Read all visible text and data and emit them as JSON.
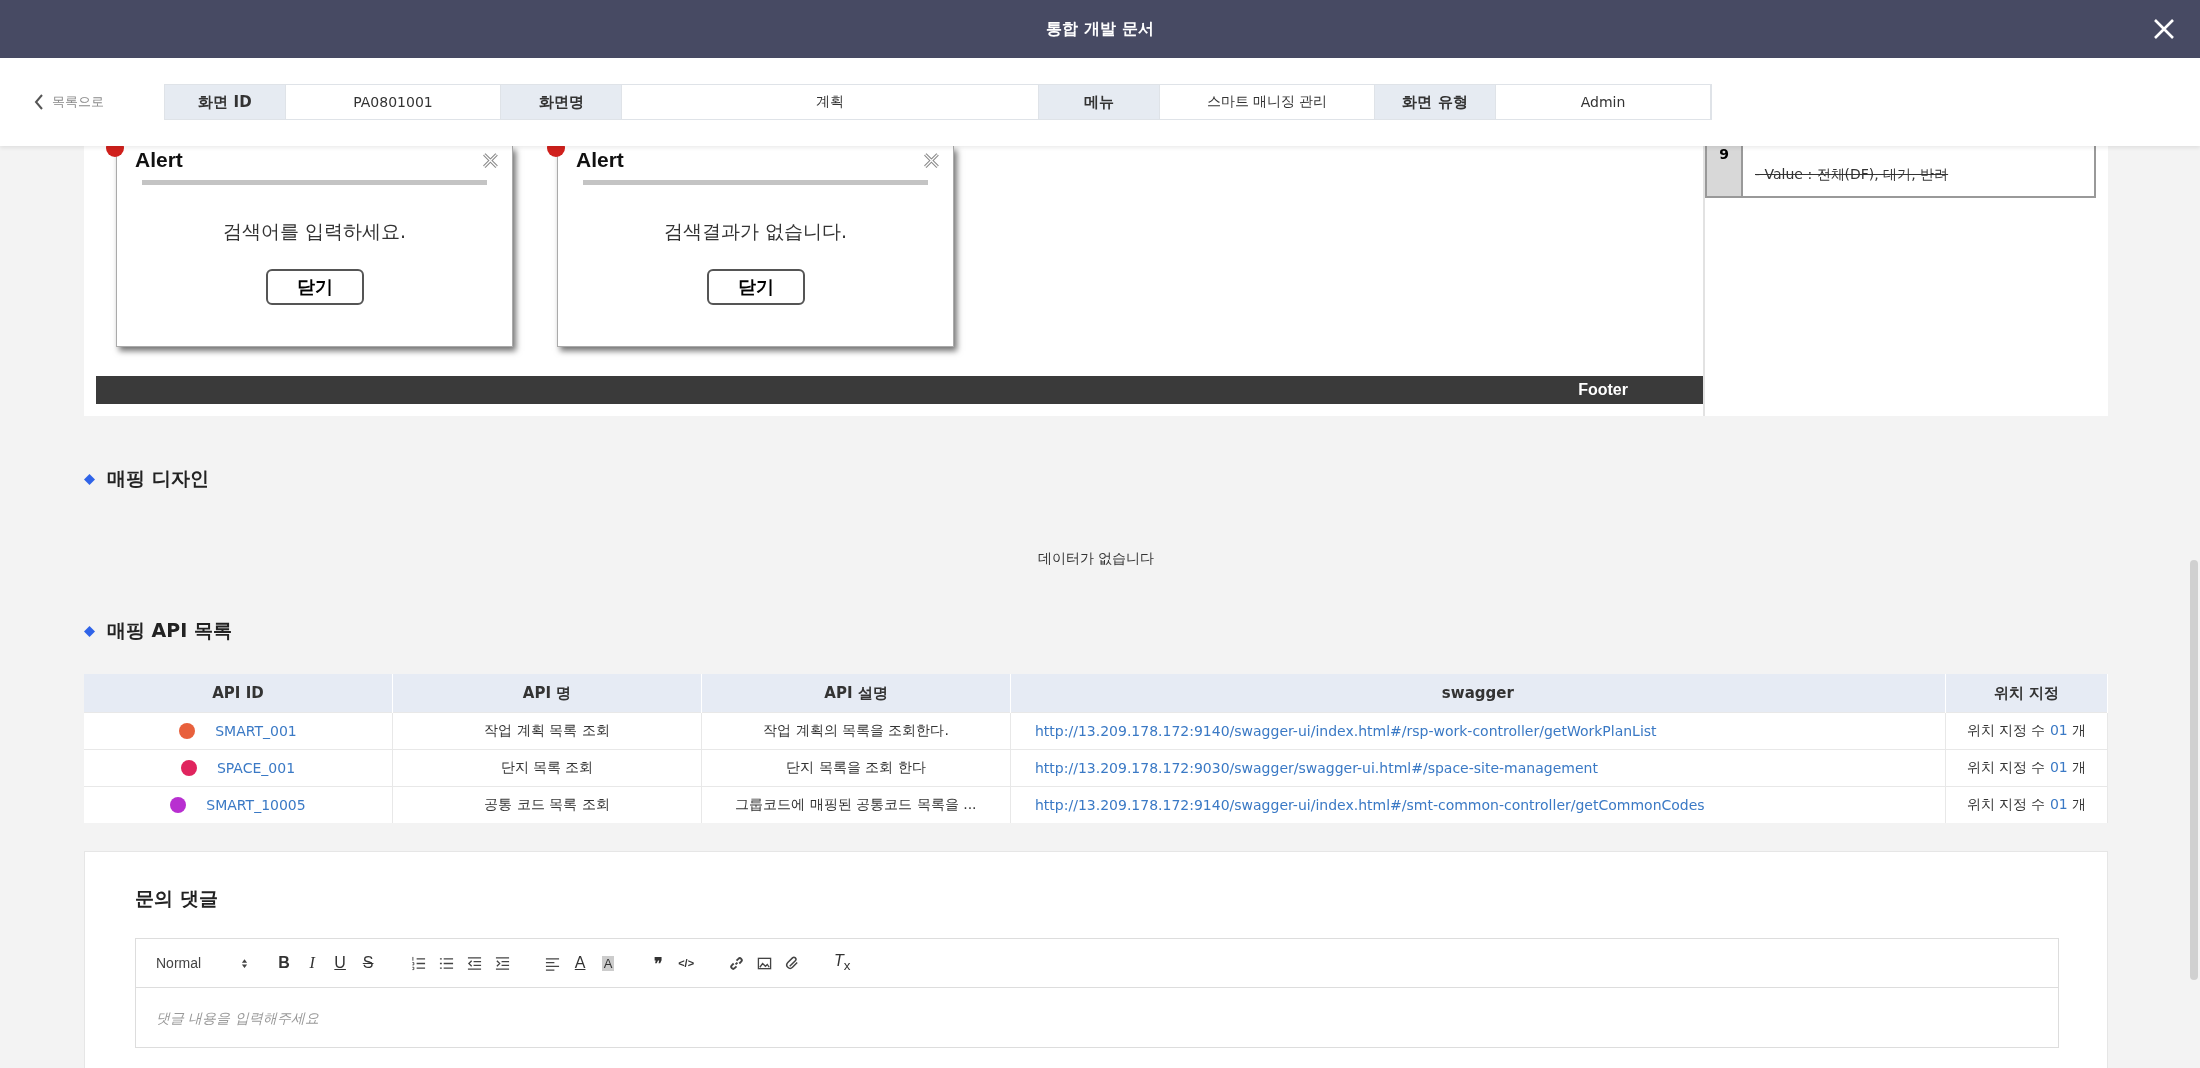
{
  "window": {
    "title": "통합 개발 문서"
  },
  "header": {
    "back_label": "목록으로",
    "fields": [
      {
        "label": "화면 ID",
        "value": "PA0801001"
      },
      {
        "label": "화면명",
        "value": "계획"
      },
      {
        "label": "메뉴",
        "value": "스마트 매니징 관리"
      },
      {
        "label": "화면 유형",
        "value": "Admin"
      }
    ]
  },
  "preview": {
    "alerts": [
      {
        "title": "Alert",
        "message": "검색어를 입력하세요.",
        "button": "닫기"
      },
      {
        "title": "Alert",
        "message": "검색결과가 없습니다.",
        "button": "닫기"
      }
    ],
    "footer": "Footer",
    "side_table": {
      "number": "9",
      "text": "- Value : 전체(DF), 대기, 반려"
    }
  },
  "mapping_design": {
    "title": "매핑 디자인",
    "empty_text": "데이터가 없습니다"
  },
  "api_list": {
    "title": "매핑 API 목록",
    "columns": [
      "API ID",
      "API 명",
      "API 설명",
      "swagger",
      "위치 지정"
    ],
    "rows": [
      {
        "color": "#e8603c",
        "id": "SMART_001",
        "name": "작업 계획 목록 조회",
        "description": "작업 계획의 목록을 조회한다.",
        "swagger": "http://13.209.178.172:9140/swagger-ui/index.html#/rsp-work-controller/getWorkPlanList",
        "location_prefix": "위치 지정 수",
        "location_count": "01",
        "location_suffix": "개"
      },
      {
        "color": "#e0245e",
        "id": "SPACE_001",
        "name": "단지 목록 조회",
        "description": "단지 목록을 조회 한다",
        "swagger": "http://13.209.178.172:9030/swagger/swagger-ui.html#/space-site-management",
        "location_prefix": "위치 지정 수",
        "location_count": "01",
        "location_suffix": "개"
      },
      {
        "color": "#b82fd0",
        "id": "SMART_10005",
        "name": "공통 코드 목록 조회",
        "description": "그룹코드에 매핑된 공통코드 목록을 ...",
        "swagger": "http://13.209.178.172:9140/swagger-ui/index.html#/smt-common-controller/getCommonCodes",
        "location_prefix": "위치 지정 수",
        "location_count": "01",
        "location_suffix": "개"
      }
    ]
  },
  "comments": {
    "title": "문의 댓글",
    "placeholder": "댓글 내용을 입력해주세요",
    "toolbar": {
      "format": "Normal",
      "labels": [
        "B",
        "I",
        "U",
        "S",
        "A",
        "A",
        "❞",
        "</>",
        "*T*$_{x}$"
      ]
    }
  }
}
